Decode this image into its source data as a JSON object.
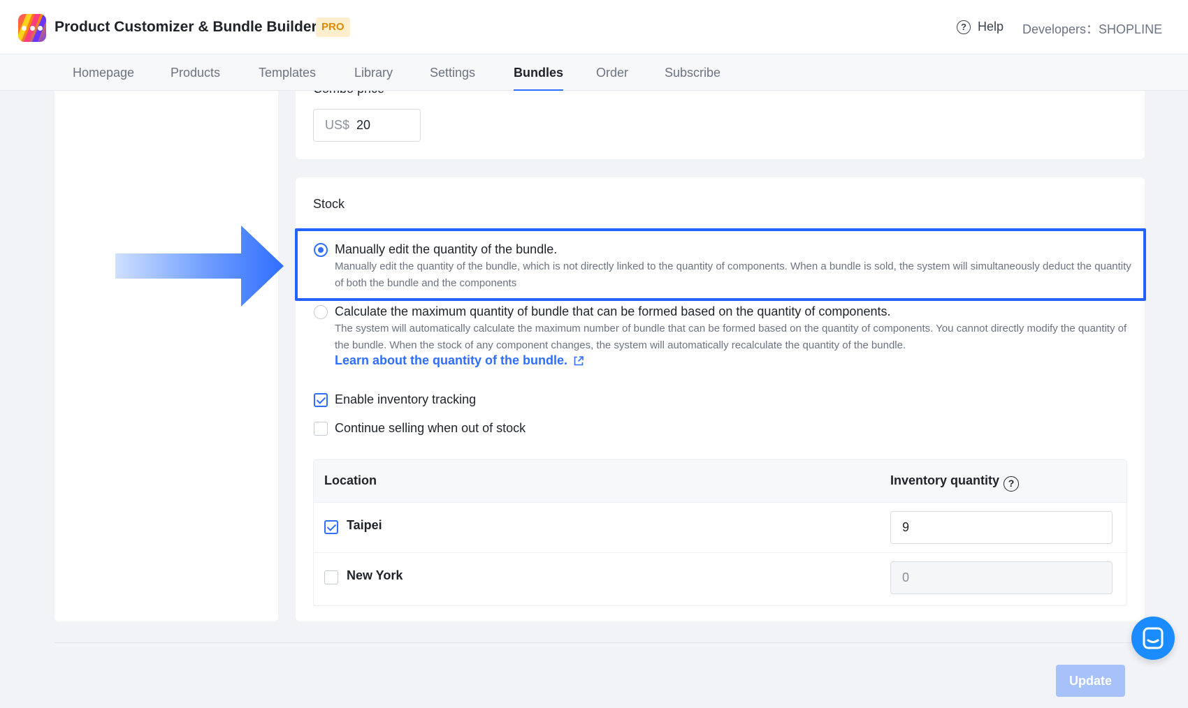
{
  "header": {
    "app_title": "Product Customizer & Bundle Builder",
    "badge": "PRO",
    "help_label": "Help",
    "help_icon": "question-circle-icon",
    "developers": "Developers：SHOPLINE"
  },
  "nav": {
    "tabs": [
      {
        "label": "Homepage"
      },
      {
        "label": "Products"
      },
      {
        "label": "Templates"
      },
      {
        "label": "Library"
      },
      {
        "label": "Settings"
      },
      {
        "label": "Bundles",
        "active": true
      },
      {
        "label": "Order"
      },
      {
        "label": "Subscribe"
      }
    ]
  },
  "pricing": {
    "label": "Combo price",
    "currency_prefix": "US$",
    "value": "20"
  },
  "stock": {
    "title": "Stock",
    "options": [
      {
        "title": "Manually edit the quantity of the bundle.",
        "description": "Manually edit the quantity of the bundle, which is not directly linked to the quantity of components. When a bundle is sold, the system will simultaneously deduct the quantity of both the bundle and the components",
        "selected": true
      },
      {
        "title": "Calculate the maximum quantity of bundle that can be formed based on the quantity of components.",
        "description": "The system will automatically calculate the maximum number of bundle that can be formed based on the quantity of components. You cannot directly modify the quantity of the bundle. When the stock of any component changes, the system will automatically recalculate the quantity of the bundle.",
        "selected": false
      }
    ],
    "learn_link": "Learn about the quantity of the bundle.",
    "enable_tracking": {
      "label": "Enable inventory tracking",
      "checked": true
    },
    "continue_selling": {
      "label": "Continue selling when out of stock",
      "checked": false
    }
  },
  "inventory": {
    "headers": {
      "location": "Location",
      "quantity": "Inventory quantity"
    },
    "rows": [
      {
        "location": "Taipei",
        "checked": true,
        "quantity": "9"
      },
      {
        "location": "New York",
        "checked": false,
        "quantity": "0"
      }
    ]
  },
  "footer": {
    "update_label": "Update"
  },
  "colors": {
    "accent": "#2f6eff",
    "highlight": "#2462ff",
    "badge_bg": "#fdeecd",
    "badge_text": "#e08a00"
  }
}
